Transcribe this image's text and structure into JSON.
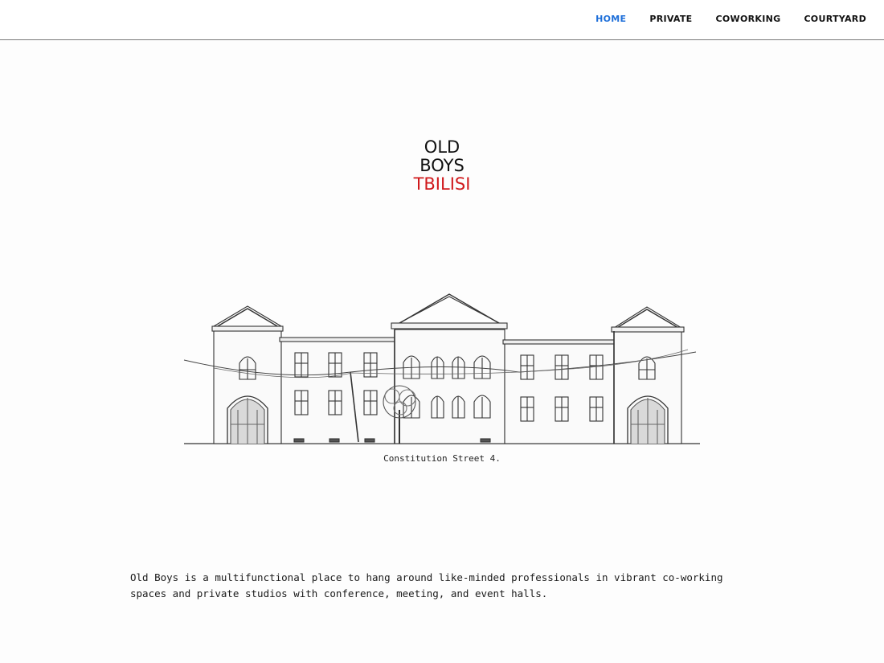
{
  "nav": {
    "items": [
      {
        "label": "HOME",
        "active": true
      },
      {
        "label": "PRIVATE",
        "active": false
      },
      {
        "label": "COWORKING",
        "active": false
      },
      {
        "label": "COURTYARD",
        "active": false
      }
    ],
    "active_color": "#1e6fd9"
  },
  "logo": {
    "line1": "OLD",
    "line2": "BOYS",
    "line3": "TBILISI",
    "accent_color": "#d0191c"
  },
  "hero": {
    "image": "building-sketch-illustration",
    "caption": "Constitution Street 4."
  },
  "intro": {
    "text": "Old Boys is a multifunctional place to hang around like-minded professionals in vibrant co-working spaces and private studios with conference, meeting, and event halls."
  }
}
